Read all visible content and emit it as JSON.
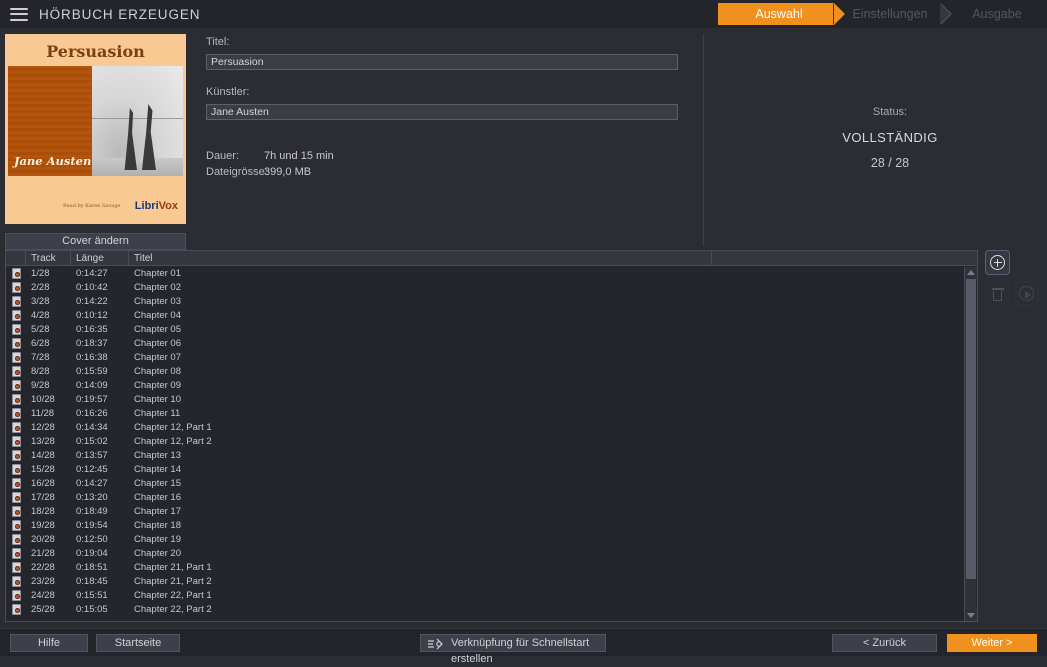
{
  "app": {
    "title": "HÖRBUCH ERZEUGEN",
    "menu_icon": "hamburger-icon"
  },
  "steps": [
    {
      "label": "Auswahl",
      "state": "active"
    },
    {
      "label": "Einstellungen",
      "state": "inactive"
    },
    {
      "label": "Ausgabe",
      "state": "inactive"
    }
  ],
  "cover": {
    "title": "Persuasion",
    "author": "Jane Austen",
    "read_by": "Read by\nKaren Savage",
    "logo_libri": "Libri",
    "logo_vox": "Vox",
    "change_button": "Cover ändern"
  },
  "form": {
    "title_label": "Titel:",
    "title_value": "Persuasion",
    "artist_label": "Künstler:",
    "artist_value": "Jane Austen",
    "duration_label": "Dauer:",
    "duration_value": "7h und 15 min",
    "filesize_label": "Dateigrösse:",
    "filesize_value": "399,0 MB"
  },
  "status": {
    "label": "Status:",
    "value": "VOLLSTÄNDIG",
    "count": "28 / 28"
  },
  "table": {
    "columns": [
      "",
      "Track",
      "Länge",
      "Titel"
    ],
    "rows": [
      {
        "track": "1/28",
        "length": "0:14:27",
        "title": "Chapter 01"
      },
      {
        "track": "2/28",
        "length": "0:10:42",
        "title": "Chapter 02"
      },
      {
        "track": "3/28",
        "length": "0:14:22",
        "title": "Chapter 03"
      },
      {
        "track": "4/28",
        "length": "0:10:12",
        "title": "Chapter 04"
      },
      {
        "track": "5/28",
        "length": "0:16:35",
        "title": "Chapter 05"
      },
      {
        "track": "6/28",
        "length": "0:18:37",
        "title": "Chapter 06"
      },
      {
        "track": "7/28",
        "length": "0:16:38",
        "title": "Chapter 07"
      },
      {
        "track": "8/28",
        "length": "0:15:59",
        "title": "Chapter 08"
      },
      {
        "track": "9/28",
        "length": "0:14:09",
        "title": "Chapter 09"
      },
      {
        "track": "10/28",
        "length": "0:19:57",
        "title": "Chapter 10"
      },
      {
        "track": "11/28",
        "length": "0:16:26",
        "title": "Chapter 11"
      },
      {
        "track": "12/28",
        "length": "0:14:34",
        "title": "Chapter 12, Part 1"
      },
      {
        "track": "13/28",
        "length": "0:15:02",
        "title": "Chapter 12, Part 2"
      },
      {
        "track": "14/28",
        "length": "0:13:57",
        "title": "Chapter 13"
      },
      {
        "track": "15/28",
        "length": "0:12:45",
        "title": "Chapter 14"
      },
      {
        "track": "16/28",
        "length": "0:14:27",
        "title": "Chapter 15"
      },
      {
        "track": "17/28",
        "length": "0:13:20",
        "title": "Chapter 16"
      },
      {
        "track": "18/28",
        "length": "0:18:49",
        "title": "Chapter 17"
      },
      {
        "track": "19/28",
        "length": "0:19:54",
        "title": "Chapter 18"
      },
      {
        "track": "20/28",
        "length": "0:12:50",
        "title": "Chapter 19"
      },
      {
        "track": "21/28",
        "length": "0:19:04",
        "title": "Chapter 20"
      },
      {
        "track": "22/28",
        "length": "0:18:51",
        "title": "Chapter 21, Part 1"
      },
      {
        "track": "23/28",
        "length": "0:18:45",
        "title": "Chapter 21, Part 2"
      },
      {
        "track": "24/28",
        "length": "0:15:51",
        "title": "Chapter 22, Part 1"
      },
      {
        "track": "25/28",
        "length": "0:15:05",
        "title": "Chapter 22, Part 2"
      }
    ]
  },
  "side_actions": {
    "add": "add-icon",
    "delete": "trash-icon",
    "play": "play-icon"
  },
  "bottom": {
    "help": "Hilfe",
    "home": "Startseite",
    "quick": "Verknüpfung für Schnellstart erstellen",
    "back": "< Zurück",
    "next": "Weiter >"
  },
  "colors": {
    "accent": "#f0901e",
    "background": "#2b2d33",
    "panel": "#23252b"
  }
}
